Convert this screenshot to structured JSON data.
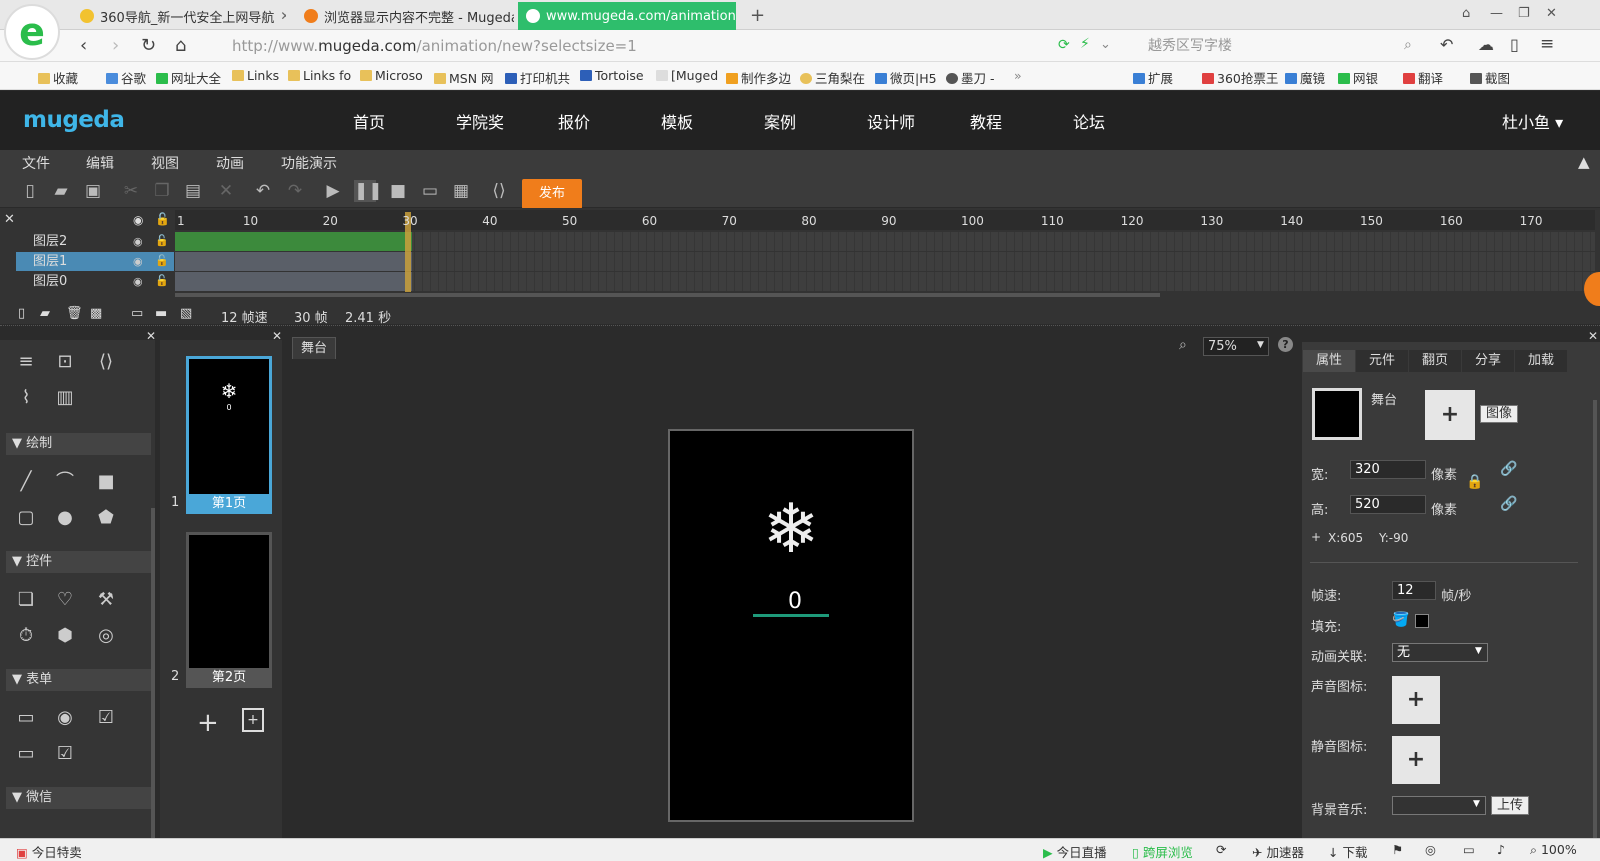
{
  "browser": {
    "tabs": [
      {
        "title": "360导航_新一代安全上网导航",
        "close": "✕"
      },
      {
        "title": "浏览器显示内容不完整 - Mugeda",
        "close": "✕"
      },
      {
        "title": "www.mugeda.com/animation/n",
        "close": "✕"
      }
    ],
    "new_tab": "+",
    "url_host": "http://www.",
    "url_domain": "mugeda.com",
    "url_path": "/animation/new?selectsize=1",
    "search_placeholder": "越秀区写字楼",
    "bookmarks": [
      "收藏",
      "谷歌",
      "网址大全",
      "Links",
      "Links fo",
      "Microso",
      "MSN 网",
      "打印机共",
      "Tortoise",
      "[Muged",
      "制作多边",
      "三角梨在",
      "微页|H5",
      "墨刀 -"
    ],
    "ext_bookmarks": [
      "扩展",
      "360抢票王",
      "魔镜",
      "网银",
      "翻译",
      "截图"
    ]
  },
  "site": {
    "logo": "mugeda",
    "nav": [
      "首页",
      "学院奖",
      "报价",
      "模板",
      "案例",
      "设计师",
      "教程",
      "论坛"
    ],
    "user": "杜小鱼 ▾"
  },
  "menus": [
    "文件",
    "编辑",
    "视图",
    "动画",
    "功能演示"
  ],
  "toolbar": {
    "publish": "发布"
  },
  "timeline": {
    "ticks": [
      "1",
      "10",
      "20",
      "30",
      "40",
      "50",
      "60",
      "70",
      "80",
      "90",
      "100",
      "110",
      "120",
      "130",
      "140",
      "150",
      "160",
      "170"
    ],
    "layers": [
      "图层2",
      "图层1",
      "图层0"
    ],
    "fps": "12 帧速",
    "frames": "30 帧",
    "seconds": "2.41 秒",
    "playhead_frame": 30
  },
  "left_panel": {
    "sections": [
      "绘制",
      "控件",
      "表单",
      "微信"
    ]
  },
  "pages": [
    {
      "num": "1",
      "label": "第1页"
    },
    {
      "num": "2",
      "label": "第2页"
    }
  ],
  "stage": {
    "tab": "舞台",
    "zoom": "75%",
    "counter": "0"
  },
  "properties": {
    "tabs": [
      "属性",
      "元件",
      "翻页",
      "分享",
      "加载"
    ],
    "stage_label": "舞台",
    "image_button": "图像",
    "width_label": "宽:",
    "width_value": "320",
    "height_label": "高:",
    "height_value": "520",
    "unit": "像素",
    "x_label": "X:605",
    "y_label": "Y:-90",
    "fps_label": "帧速:",
    "fps_value": "12",
    "fps_unit": "帧/秒",
    "fill_label": "填充:",
    "anim_link_label": "动画关联:",
    "anim_link_value": "无",
    "sound_icon_label": "声音图标:",
    "mute_icon_label": "静音图标:",
    "bg_music_label": "背景音乐:",
    "upload_button": "上传"
  },
  "statusbar": {
    "left": "今日特卖",
    "items": [
      "今日直播",
      "跨屏浏览",
      "加速器",
      "下载"
    ],
    "zoom": "100%"
  },
  "colors": {
    "accent_blue": "#4aa7d8",
    "publish_orange": "#f07d1b",
    "tab_active_green": "#2ebe6c",
    "progress_teal": "#1e9a7a"
  }
}
